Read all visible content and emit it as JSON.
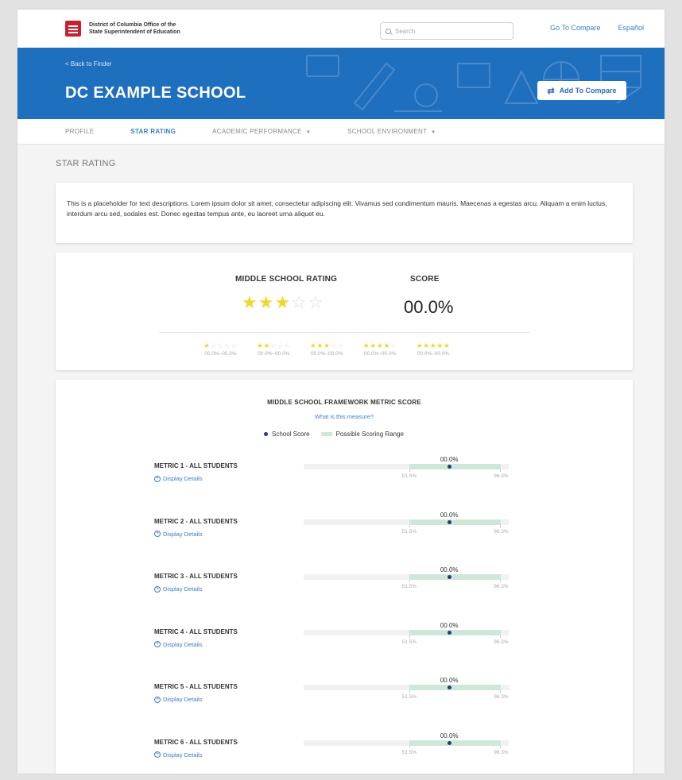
{
  "header": {
    "org_line1": "District of Columbia Office of the",
    "org_line2": "State Superintendent of Education",
    "logo_text": "OSSE",
    "search_placeholder": "Search",
    "go_to_compare": "Go To Compare",
    "language": "Español"
  },
  "hero": {
    "back_link": "< Back to Finder",
    "school_name": "DC EXAMPLE SCHOOL",
    "add_to_compare": "Add To Compare"
  },
  "tabs": [
    {
      "label": "PROFILE",
      "active": false,
      "dropdown": false
    },
    {
      "label": "STAR RATING",
      "active": true,
      "dropdown": false
    },
    {
      "label": "ACADEMIC PERFORMANCE",
      "active": false,
      "dropdown": true
    },
    {
      "label": "SCHOOL ENVIRONMENT",
      "active": false,
      "dropdown": true
    }
  ],
  "section_title": "STAR RATING",
  "description": "This is a placeholder for text descriptions. Lorem ipsum dolor sit amet, consectetur adipiscing elit. Vivamus sed condimentum mauris. Maecenas a egestas arcu. Aliquam a enim luctus, interdum arcu sed, sodales est. Donec egestas tempus ante, eu laoreet urna aliquet eu.",
  "rating": {
    "heading": "MIDDLE SCHOOL RATING",
    "score_heading": "SCORE",
    "stars": 3,
    "max_stars": 5,
    "score": "00.0%",
    "legend": [
      {
        "stars": 1,
        "range": "00.0%–00.0%"
      },
      {
        "stars": 2,
        "range": "00.0%–00.0%"
      },
      {
        "stars": 3,
        "range": "00.0%–00.0%"
      },
      {
        "stars": 4,
        "range": "00.0%–00.0%"
      },
      {
        "stars": 5,
        "range": "00.0%–00.0%"
      }
    ]
  },
  "metrics": {
    "title": "MIDDLE SCHOOL FRAMEWORK METRIC SCORE",
    "link": "What is this measure?",
    "legend_school": "School Score",
    "legend_range": "Possible Scoring Range",
    "display_details": "Display Details",
    "colors": {
      "school_score": "#1e3f7a",
      "range": "#cfe7d8"
    },
    "items": [
      {
        "label": "METRIC 1 - ALL STUDENTS",
        "score": "00.0%",
        "score_value": 71.0,
        "range_min": 51.5,
        "range_max": 96.3,
        "range_min_label": "51.5%",
        "range_max_label": "96.3%"
      },
      {
        "label": "METRIC 2 - ALL STUDENTS",
        "score": "00.0%",
        "score_value": 71.0,
        "range_min": 51.5,
        "range_max": 96.3,
        "range_min_label": "51.5%",
        "range_max_label": "96.3%"
      },
      {
        "label": "METRIC 3 - ALL STUDENTS",
        "score": "00.0%",
        "score_value": 71.0,
        "range_min": 51.5,
        "range_max": 96.3,
        "range_min_label": "51.5%",
        "range_max_label": "96.3%"
      },
      {
        "label": "METRIC 4 - ALL STUDENTS",
        "score": "00.0%",
        "score_value": 71.0,
        "range_min": 51.5,
        "range_max": 96.3,
        "range_min_label": "51.5%",
        "range_max_label": "96.3%"
      },
      {
        "label": "METRIC 5 - ALL STUDENTS",
        "score": "00.0%",
        "score_value": 71.0,
        "range_min": 51.5,
        "range_max": 96.3,
        "range_min_label": "51.5%",
        "range_max_label": "96.3%"
      },
      {
        "label": "METRIC 6 - ALL STUDENTS",
        "score": "00.0%",
        "score_value": 71.0,
        "range_min": 51.5,
        "range_max": 96.3,
        "range_min_label": "51.5%",
        "range_max_label": "96.3%"
      }
    ]
  }
}
